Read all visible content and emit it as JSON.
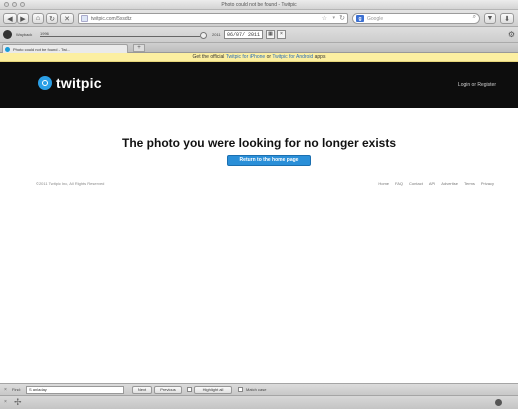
{
  "window": {
    "title": "Photo could not be found - Twitpic"
  },
  "toolbar": {
    "back_icon": "back-arrow-icon",
    "forward_icon": "forward-arrow-icon",
    "url": "twitpic.com/5xsdtz",
    "search_placeholder": "Google"
  },
  "wayback": {
    "label": "Wayback",
    "year_left": "1996",
    "year_right": "2011",
    "date": "06/07/ 2011",
    "cal_icon": "calendar-icon",
    "close_icon": "close-icon"
  },
  "tab": {
    "label": "Photo could not be found - Twi...",
    "new_tab": "+"
  },
  "notice": {
    "prefix": "Get the official",
    "link1": "Twitpic for iPhone",
    "or": "or",
    "link2": "Twitpic for Android",
    "suffix": "apps"
  },
  "header": {
    "brand": "twitpic",
    "login": "Login or Register"
  },
  "main": {
    "headline": "The photo you were looking for no longer exists",
    "home_button": "Return to the home page"
  },
  "footer": {
    "copyright": "©2011 Twitpic Inc, All Rights Reserved",
    "links": [
      "Home",
      "FAQ",
      "Contact",
      "API",
      "Advertise",
      "Terms",
      "Privacy"
    ]
  },
  "findbar": {
    "label": "Find:",
    "value": "S anladay",
    "next": "Next",
    "previous": "Previous",
    "highlight": "Highlight all",
    "match_case": "Match case"
  },
  "colors": {
    "header_bg": "#0d0d0d",
    "brand_blue": "#2b9fe6",
    "button_blue": "#2a8fd8",
    "notice_bg": "#fcefa1"
  }
}
